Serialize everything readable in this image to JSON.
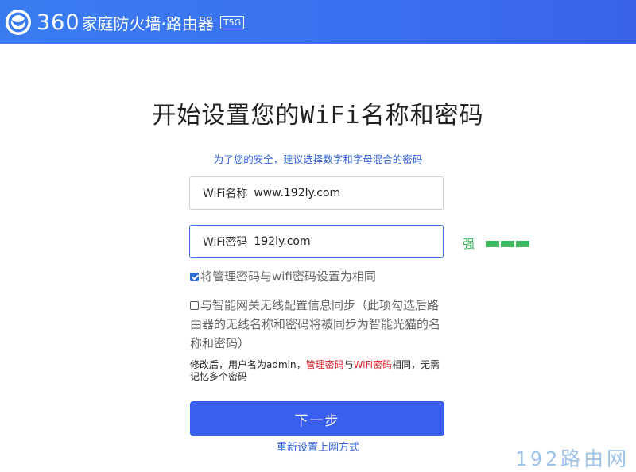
{
  "header": {
    "brand_number": "360",
    "brand_text": "家庭防火墙·路由器",
    "model": "T5G",
    "accent_color": "#3a6ff0"
  },
  "main": {
    "title": "开始设置您的WiFi名称和密码",
    "subtitle": "为了您的安全，建议选择数字和字母混合的密码",
    "wifi_name": {
      "label": "WiFi名称",
      "value": "www.192ly.com"
    },
    "wifi_password": {
      "label": "WiFi密码",
      "value": "192ly.com",
      "strength_label": "强",
      "strength_color": "#3cb85e"
    },
    "checkbox_same_admin": {
      "label": "将管理密码与wifi密码设置为相同",
      "checked": true
    },
    "checkbox_sync": {
      "label": "与智能网关无线配置信息同步（此项勾选后路由器的无线名称和密码将被同步为智能光猫的名称和密码）",
      "checked": false
    },
    "note": {
      "part1": "修改后，用户名为admin，",
      "part2": "管理密码",
      "part3": "与",
      "part4": "WiFi密码",
      "part5": "相同，无需记忆多个密码"
    },
    "next_button": "下一步",
    "reset_link": "重新设置上网方式"
  },
  "watermark": "192路由网"
}
